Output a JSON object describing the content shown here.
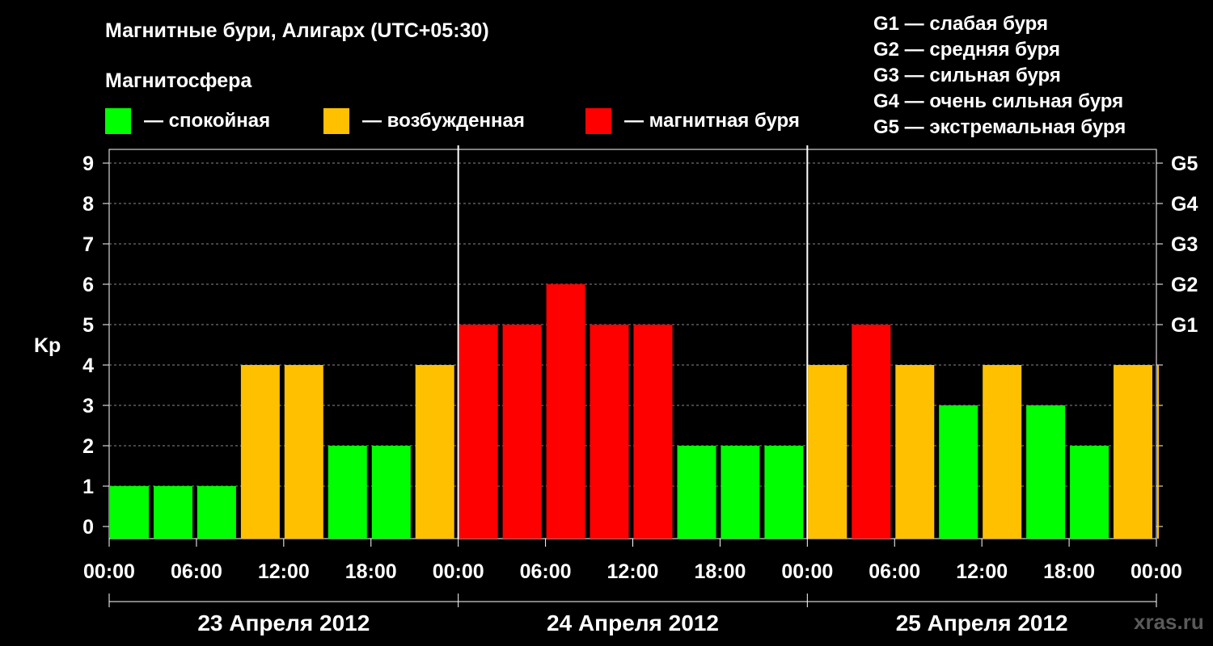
{
  "header": {
    "title": "Магнитные бури, Алигарх (UTC+05:30)",
    "subtitle": "Магнитосфера"
  },
  "legend": [
    {
      "label": "— спокойная",
      "color": "#00ff00"
    },
    {
      "label": "— возбужденная",
      "color": "#ffc000"
    },
    {
      "label": "— магнитная буря",
      "color": "#ff0000"
    }
  ],
  "storm_scale": [
    "G1 — слабая буря",
    "G2 — средняя буря",
    "G3 — сильная буря",
    "G4 — очень сильная буря",
    "G5 — экстремальная буря"
  ],
  "watermark": "xras.ru",
  "chart_data": {
    "type": "bar",
    "ylabel": "Kp",
    "ylim": [
      0,
      9
    ],
    "yticks": [
      "0",
      "1",
      "2",
      "3",
      "4",
      "5",
      "6",
      "7",
      "8",
      "9"
    ],
    "right_axis_labels": [
      {
        "kp": 5,
        "label": "G1"
      },
      {
        "kp": 6,
        "label": "G2"
      },
      {
        "kp": 7,
        "label": "G3"
      },
      {
        "kp": 8,
        "label": "G4"
      },
      {
        "kp": 9,
        "label": "G5"
      }
    ],
    "grid": true,
    "xticks": [
      "00:00",
      "06:00",
      "12:00",
      "18:00",
      "00:00",
      "06:00",
      "12:00",
      "18:00",
      "00:00",
      "06:00",
      "12:00",
      "18:00",
      "00:00"
    ],
    "days": [
      "23 Апреля 2012",
      "24 Апреля 2012",
      "25 Апреля 2012"
    ],
    "interval_hours": 3,
    "values": [
      1,
      1,
      1,
      4,
      4,
      2,
      2,
      4,
      5,
      5,
      6,
      5,
      5,
      2,
      2,
      2,
      4,
      5,
      4,
      3,
      4,
      3,
      2,
      4,
      4
    ],
    "colors": {
      "calm": "#00ff00",
      "active": "#ffc000",
      "storm": "#ff0000"
    }
  }
}
